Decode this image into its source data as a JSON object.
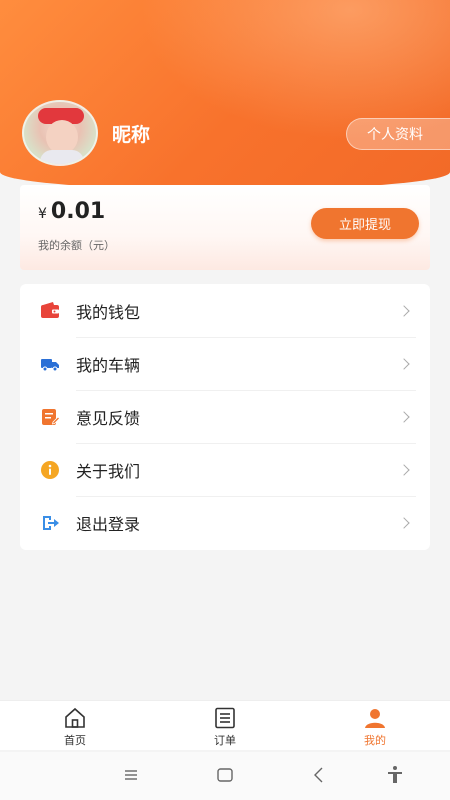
{
  "profile": {
    "nickname": "昵称",
    "profile_button": "个人资料"
  },
  "balance": {
    "currency": "¥",
    "amount": "0.01",
    "label": "我的余额（元）",
    "withdraw_button": "立即提现"
  },
  "menu": {
    "items": [
      {
        "label": "我的钱包",
        "icon": "wallet-icon",
        "color": "#e8443a"
      },
      {
        "label": "我的车辆",
        "icon": "truck-icon",
        "color": "#2a6fd6"
      },
      {
        "label": "意见反馈",
        "icon": "feedback-icon",
        "color": "#f0752f"
      },
      {
        "label": "关于我们",
        "icon": "info-icon",
        "color": "#f5a623"
      },
      {
        "label": "退出登录",
        "icon": "logout-icon",
        "color": "#3a8ee6"
      }
    ]
  },
  "tabs": [
    {
      "label": "首页",
      "icon": "home-icon",
      "active": false
    },
    {
      "label": "订单",
      "icon": "list-icon",
      "active": false
    },
    {
      "label": "我的",
      "icon": "user-icon",
      "active": true
    }
  ],
  "colors": {
    "accent": "#f0752f",
    "header_start": "#ff8d3e",
    "header_end": "#f26a28"
  }
}
